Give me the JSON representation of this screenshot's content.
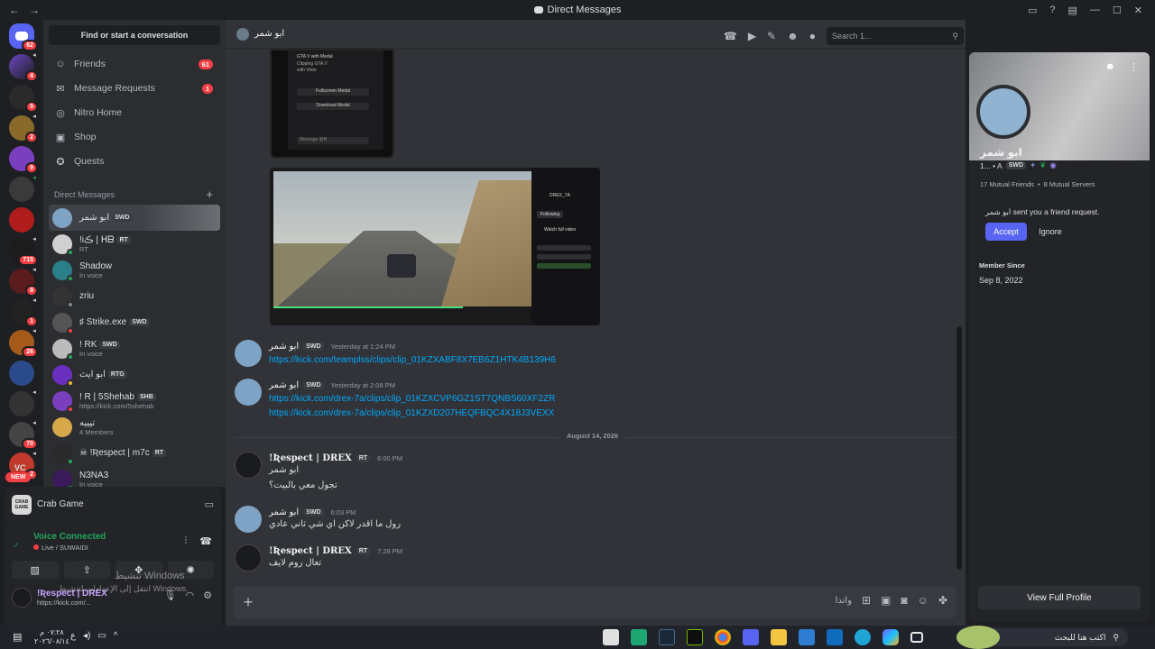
{
  "window": {
    "title": "Direct Messages",
    "back": "←",
    "forward": "→"
  },
  "servers": [
    {
      "badge": "62"
    },
    {
      "badge": "4"
    },
    {
      "badge": "5"
    },
    {
      "badge": "2"
    },
    {
      "badge": "9"
    },
    {
      "badge": ""
    },
    {
      "badge": ""
    },
    {
      "badge": "715"
    },
    {
      "badge": "8"
    },
    {
      "badge": "1"
    },
    {
      "badge": "26"
    },
    {
      "badge": ""
    },
    {
      "badge": ""
    },
    {
      "badge": "70"
    },
    {
      "badge": "2"
    }
  ],
  "server_new": "NEW",
  "server_vc": "VC",
  "sidebar": {
    "find": "Find or start a conversation",
    "nav": [
      {
        "label": "Friends",
        "count": "61"
      },
      {
        "label": "Message Requests",
        "count": "1"
      },
      {
        "label": "Nitro Home",
        "count": ""
      },
      {
        "label": "Shop",
        "count": ""
      },
      {
        "label": "Quests",
        "count": ""
      }
    ],
    "dm_header": "Direct Messages",
    "dm_add": "+",
    "dms": [
      {
        "name": "ابو شمر",
        "tag": "SWD",
        "sub": ""
      },
      {
        "name": "!iڪ | ᕼᗷ",
        "tag": "RT",
        "sub": "RT"
      },
      {
        "name": "Shadow",
        "tag": "",
        "sub": "In voice"
      },
      {
        "name": "zriu",
        "tag": "",
        "sub": ""
      },
      {
        "name": "♯ Strike.exe",
        "tag": "SWD",
        "sub": ""
      },
      {
        "name": "! RK",
        "tag": "SWD",
        "sub": "In voice"
      },
      {
        "name": "ابو ايث",
        "tag": "RTG",
        "sub": ""
      },
      {
        "name": "! R | 5Shehab",
        "tag": "SHB",
        "sub": "https://kick.com/5shehab"
      },
      {
        "name": "تيييه",
        "tag": "",
        "sub": "4 Members"
      },
      {
        "name": "☠ !Ʀespect | m7c",
        "tag": "RT",
        "sub": ""
      },
      {
        "name": "N3NA3",
        "tag": "",
        "sub": "In voice"
      }
    ]
  },
  "panel": {
    "game": "Crab Game",
    "game_icon_text": "CRAB GAME",
    "voice_title": "Voice Connected",
    "voice_sub": "Live / SUWAIDI",
    "user_name": "!Ʀespect | DREX",
    "user_status": "https://kick.com/..."
  },
  "os_watermark": {
    "line1": "تنشيط Windows",
    "line2": "انتقل إلى الإعدادات لتنشيط Windows."
  },
  "chat": {
    "peer": "ابو شمر",
    "search_placeholder": "Search 1...",
    "img1_lines": [
      "GTA V with Medal",
      "Clipping GTA V",
      "with Vinto",
      "Fullscreen Medal",
      "Download Medal",
      "Message @N"
    ],
    "img2_channel": "DREX_7A",
    "img2_follow": "Following",
    "img2_watch": "Watch full video",
    "messages": [
      {
        "author": "ابو شمر",
        "tag": "SWD",
        "time": "Yesterday at 1:24 PM",
        "lines": [
          "https://kick.com/teamplss/clips/clip_01KZXABF8X7EB6Z1HTK4B139H6"
        ],
        "link": true
      },
      {
        "author": "ابو شمر",
        "tag": "SWD",
        "time": "Yesterday at 2:08 PM",
        "lines": [
          "https://kick.com/drex-7a/clips/clip_01KZXCVP6GZ1ST7QNBS60XF2ZR",
          "https://kick.com/drex-7a/clips/clip_01KZXD207HEQFBQC4X18J3VEXX"
        ],
        "link": true
      },
      {
        "author": "!Ʀespect | DREX",
        "tag": "RT",
        "time": "6:00 PM",
        "lines": [
          "ابو شمر",
          "تجول معي بالبيت؟"
        ],
        "link": false
      },
      {
        "author": "ابو شمر",
        "tag": "SWD",
        "time": "6:03 PM",
        "lines": [
          "رول ما اقدر لاكن اي شي ثاني عادي"
        ],
        "link": false
      },
      {
        "author": "!Ʀespect | DREX",
        "tag": "RT",
        "time": "7:28 PM",
        "lines": [
          "تعال روم لايف"
        ],
        "link": false
      }
    ],
    "date_divider": "August 14, 2026",
    "composer_text": "واتدا"
  },
  "profile": {
    "name": "ابو شمر",
    "tag_prefix": "1... • A",
    "tag": "SWD",
    "mutual_friends": "17 Mutual Friends",
    "mutual_servers": "8 Mutual Servers",
    "request_name": "ابو شمر",
    "request_text": "sent you a friend request.",
    "accept": "Accept",
    "ignore": "Ignore",
    "member_since_label": "Member Since",
    "member_since": "Sep 8, 2022",
    "view_full": "View Full Profile"
  },
  "taskbar": {
    "time": "٠٧:٢٨ م",
    "date": "٢٠٢٦/٠٨/١٤",
    "lang": "ع",
    "search": "اكتب هنا للبحث"
  }
}
